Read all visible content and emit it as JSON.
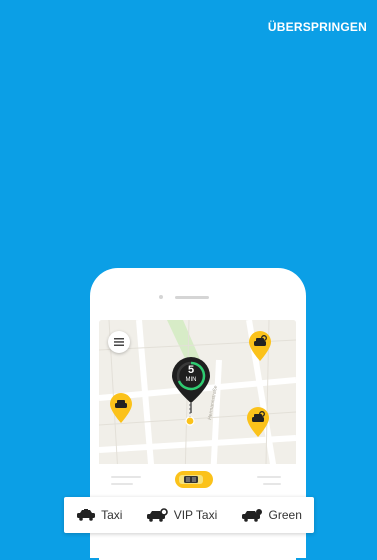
{
  "header": {
    "skip_label": "ÜBERSPRINGEN"
  },
  "map": {
    "eta": {
      "value": "5",
      "unit": "MIN"
    },
    "street_label": "Hermannstraße"
  },
  "ride_types": [
    {
      "label": "Taxi",
      "icon": "taxi-icon"
    },
    {
      "label": "VIP Taxi",
      "icon": "vip-taxi-icon"
    },
    {
      "label": "Green",
      "icon": "green-taxi-icon"
    }
  ],
  "colors": {
    "background": "#0b9fe6",
    "accent_yellow": "#fbc21a",
    "eta_pin": "#1f1f1f",
    "eta_ring": "#2ecc71"
  }
}
